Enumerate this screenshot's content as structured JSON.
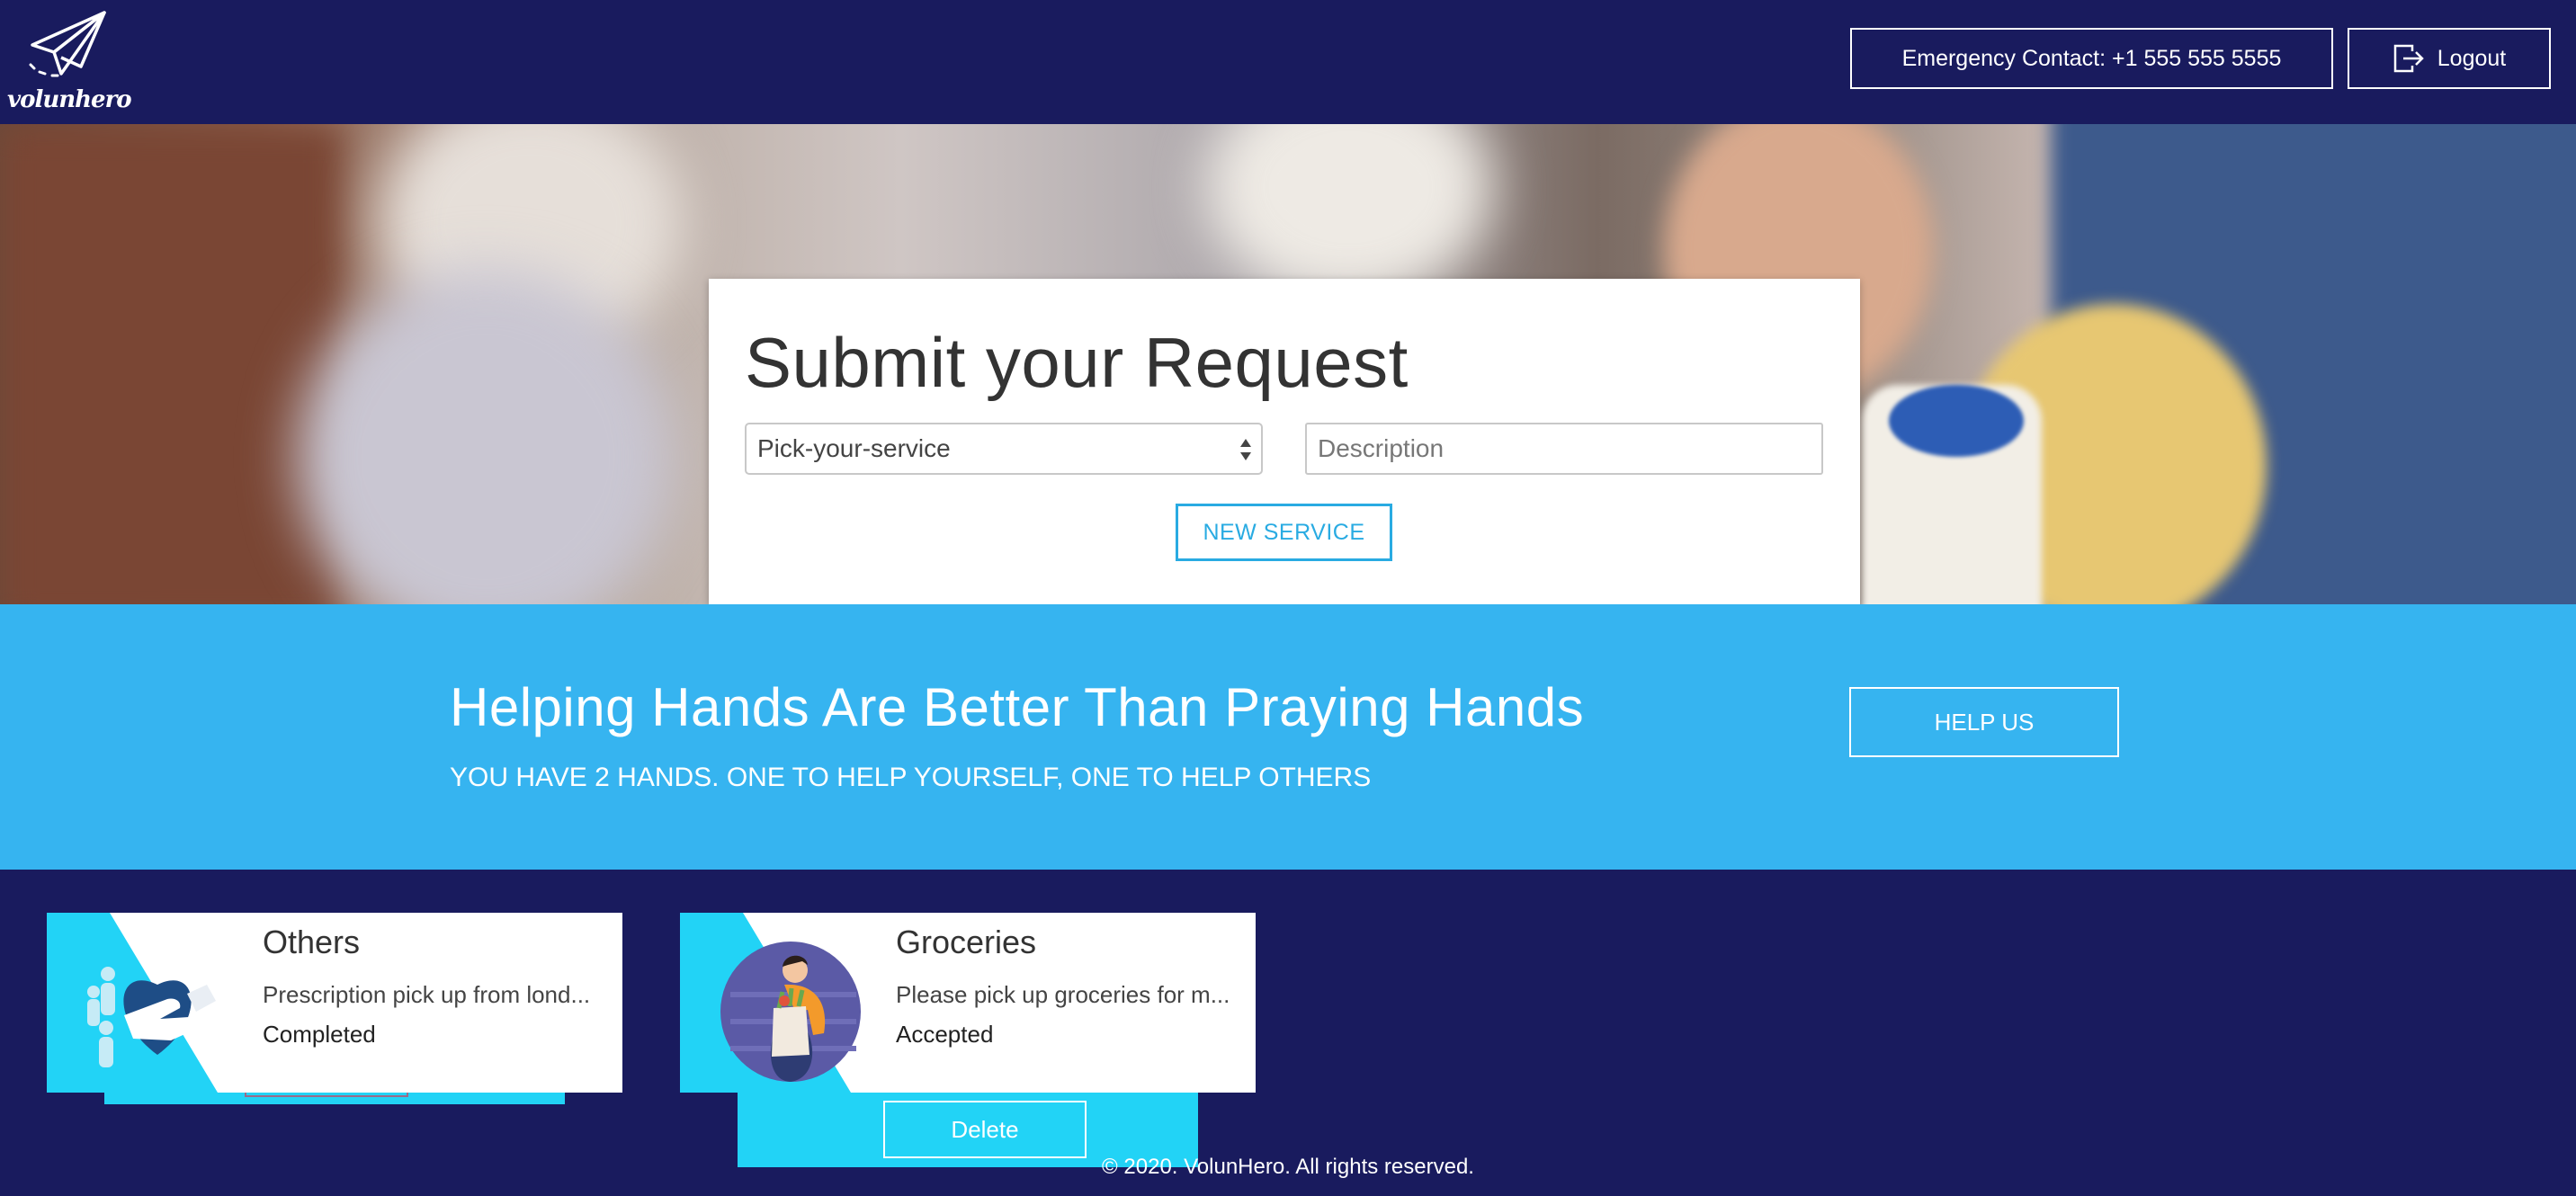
{
  "header": {
    "logo_text": "volunhero",
    "emergency_label": "Emergency Contact: +1 555 555 5555",
    "logout_label": "Logout"
  },
  "request_form": {
    "title": "Submit your Request",
    "service_select_value": "Pick-your-service",
    "description_placeholder": "Description",
    "new_service_label": "NEW SERVICE"
  },
  "banner": {
    "title": "Helping Hands Are Better Than Praying Hands",
    "subtitle": "YOU HAVE 2 HANDS. ONE TO HELP YOURSELF, ONE TO HELP OTHERS",
    "help_label": "HELP US"
  },
  "requests": [
    {
      "category": "Others",
      "description": "Prescription pick up from lond...",
      "status": "Completed",
      "icon": "heart-hand-icon"
    },
    {
      "category": "Groceries",
      "description": "Please pick up groceries for m...",
      "status": "Accepted",
      "icon": "grocery-person-icon",
      "delete_label": "Delete"
    }
  ],
  "footer": {
    "copyright": "© 2020. VolunHero. All rights reserved."
  },
  "colors": {
    "navy": "#191b5e",
    "sky_blue": "#36b4f0",
    "cyan_accent": "#22d3f6",
    "button_blue": "#29abe2"
  }
}
